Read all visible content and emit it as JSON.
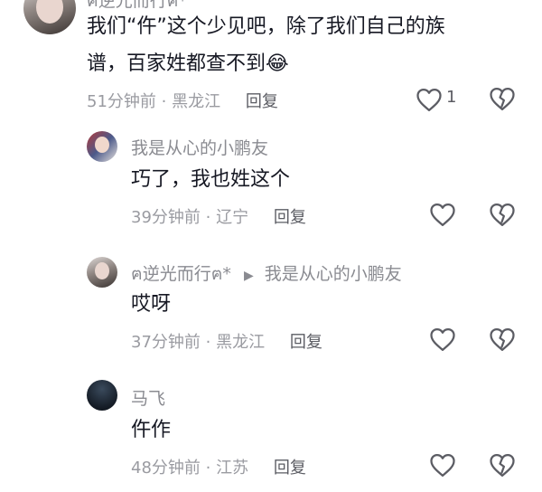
{
  "comments": [
    {
      "author": "ฅ逆光而行ฅ*",
      "text_line1": "我们“仵”这个少见吧，除了我们自己的族",
      "text_line2": "谱，百家姓都查不到",
      "emoji": "😂",
      "time": "51分钟前",
      "location": "黑龙江",
      "reply": "回复",
      "likes": "1"
    },
    {
      "author": "我是从心的小鹏友",
      "text": "巧了，我也姓这个",
      "time": "39分钟前",
      "location": "辽宁",
      "reply": "回复"
    },
    {
      "author": "ฅ逆光而行ฅ*",
      "reply_to": "我是从心的小鹏友",
      "text": "哎呀",
      "time": "37分钟前",
      "location": "黑龙江",
      "reply": "回复"
    },
    {
      "author": "马飞",
      "text": "仵作",
      "time": "48分钟前",
      "location": "江苏",
      "reply": "回复"
    }
  ],
  "colors": {
    "icon": "#5b5c63",
    "meta": "#9a9ba1",
    "name": "#8a8b91",
    "text": "#161823"
  }
}
